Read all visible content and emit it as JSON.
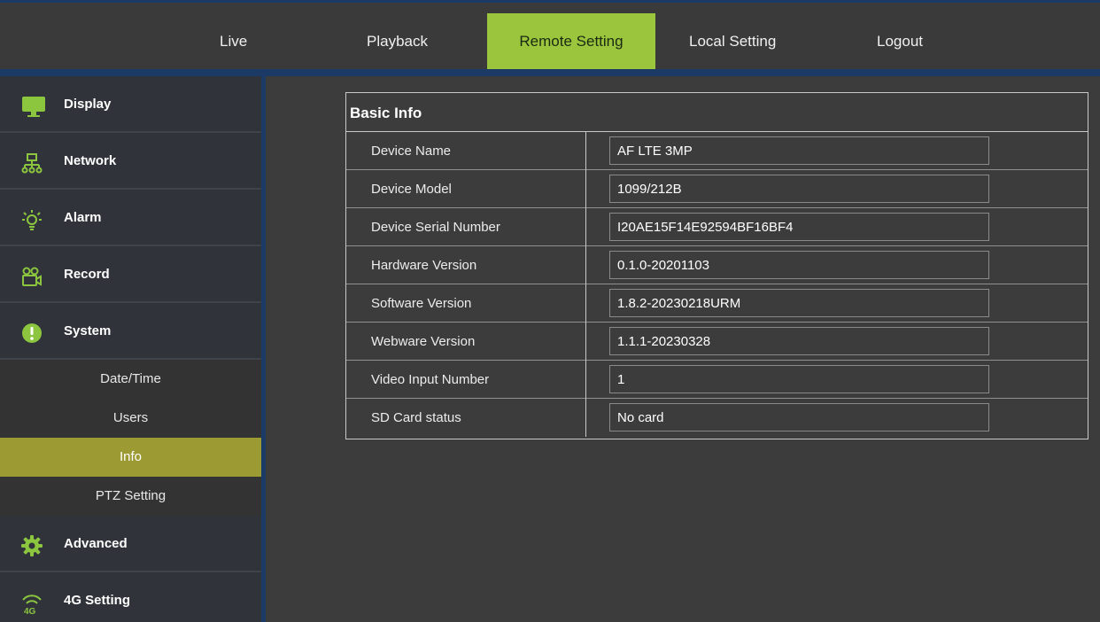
{
  "nav": {
    "tabs": [
      {
        "label": "Live"
      },
      {
        "label": "Playback"
      },
      {
        "label": "Remote Setting",
        "active": true
      },
      {
        "label": "Local Setting"
      },
      {
        "label": "Logout"
      }
    ]
  },
  "sidebar": {
    "menu": [
      {
        "label": "Display",
        "icon": "monitor-icon"
      },
      {
        "label": "Network",
        "icon": "network-icon"
      },
      {
        "label": "Alarm",
        "icon": "alarm-icon"
      },
      {
        "label": "Record",
        "icon": "record-icon"
      },
      {
        "label": "System",
        "icon": "exclamation-icon"
      },
      {
        "label": "Advanced",
        "icon": "gear-icon"
      },
      {
        "label": "4G Setting",
        "icon": "signal-4g-icon"
      }
    ],
    "system_submenu": [
      {
        "label": "Date/Time"
      },
      {
        "label": "Users"
      },
      {
        "label": "Info",
        "active": true
      },
      {
        "label": "PTZ Setting"
      }
    ]
  },
  "basic_info": {
    "title": "Basic Info",
    "rows": [
      {
        "label": "Device Name",
        "value": "AF LTE 3MP"
      },
      {
        "label": "Device Model",
        "value": "1099/212B"
      },
      {
        "label": "Device Serial Number",
        "value": "I20AE15F14E92594BF16BF4"
      },
      {
        "label": "Hardware Version",
        "value": "0.1.0-20201103"
      },
      {
        "label": "Software Version",
        "value": "1.8.2-20230218URM"
      },
      {
        "label": "Webware Version",
        "value": "1.1.1-20230328"
      },
      {
        "label": "Video Input Number",
        "value": "1"
      },
      {
        "label": "SD Card status",
        "value": "No card"
      }
    ]
  },
  "colors": {
    "accent": "#9bc53d",
    "submenu_active": "#9c9a32",
    "frame": "#1c3a66",
    "icon_green": "#8cc63f"
  }
}
